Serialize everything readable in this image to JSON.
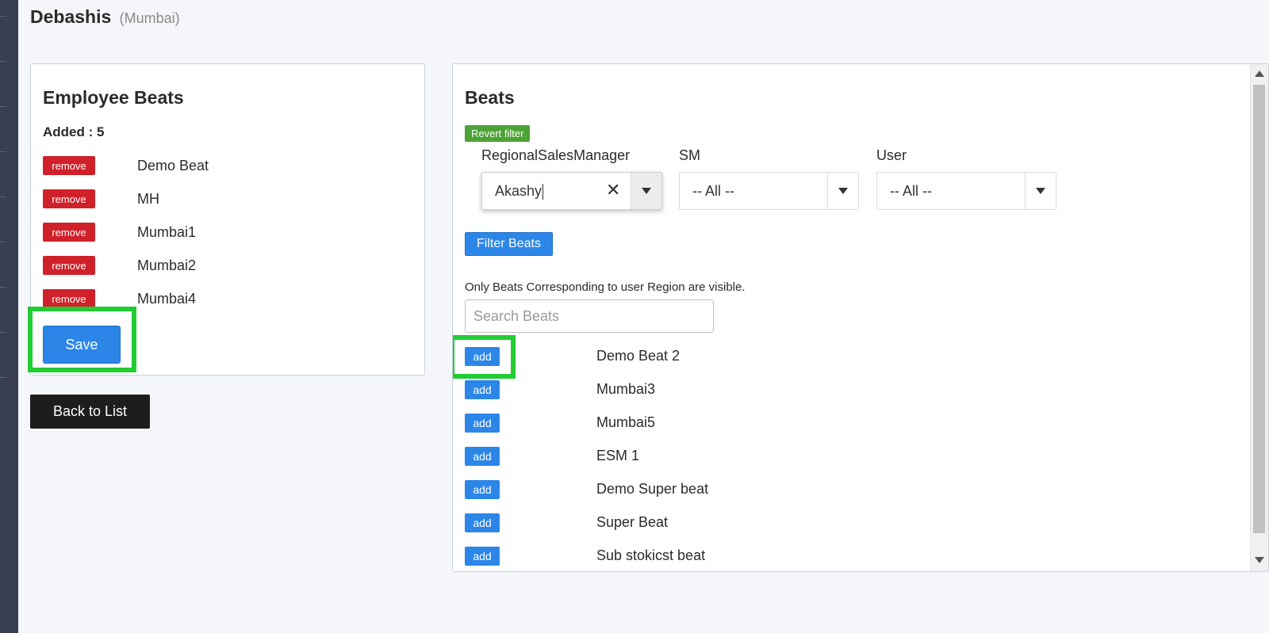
{
  "header": {
    "name": "Debashis",
    "location": "(Mumbai)"
  },
  "employee_beats": {
    "title": "Employee Beats",
    "added_label": "Added : 5",
    "remove_label": "remove",
    "items": [
      "Demo Beat",
      "MH",
      "Mumbai1",
      "Mumbai2",
      "Mumbai4"
    ],
    "save_label": "Save"
  },
  "back_label": "Back to List",
  "beats": {
    "title": "Beats",
    "revert_label": "Revert filter",
    "filters": {
      "rsm": {
        "label": "RegionalSalesManager",
        "value": "Akashy",
        "clear_icon": "✕"
      },
      "sm": {
        "label": "SM",
        "value": "-- All --"
      },
      "user": {
        "label": "User",
        "value": "-- All --"
      }
    },
    "filter_button": "Filter Beats",
    "note": "Only Beats Corresponding to user Region are visible.",
    "search_placeholder": "Search Beats",
    "add_label": "add",
    "items": [
      "Demo Beat 2",
      "Mumbai3",
      "Mumbai5",
      "ESM 1",
      "Demo Super beat",
      "Super Beat",
      "Sub stokicst beat"
    ]
  },
  "colors": {
    "remove": "#d0202a",
    "add": "#2c86e8",
    "revert": "#4da236",
    "highlight": "#22cc33",
    "back": "#1d1d1d",
    "sidebar": "#393f50"
  }
}
